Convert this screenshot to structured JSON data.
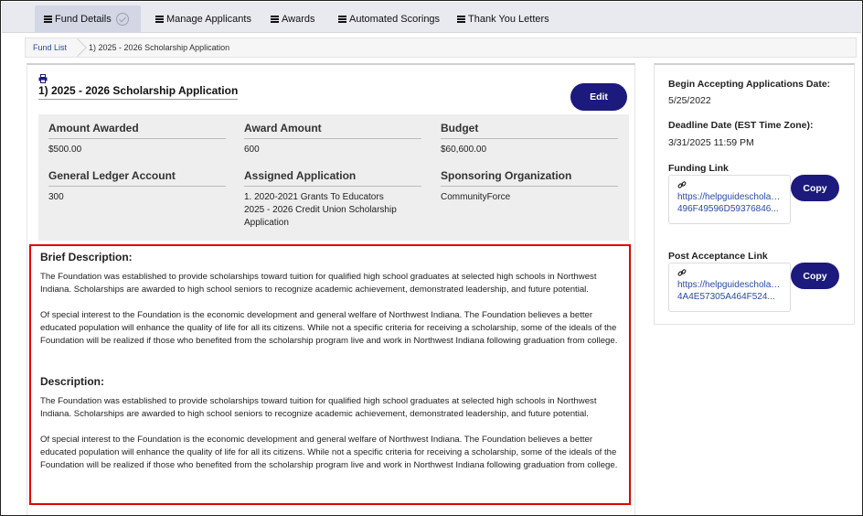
{
  "tabs": [
    {
      "label": "Fund Details"
    },
    {
      "label": "Manage Applicants"
    },
    {
      "label": "Awards"
    },
    {
      "label": "Automated Scorings"
    },
    {
      "label": "Thank You Letters"
    }
  ],
  "breadcrumb": {
    "root": "Fund List",
    "current": "1) 2025 - 2026 Scholarship Application"
  },
  "fund": {
    "title": "1) 2025 - 2026 Scholarship Application",
    "edit_label": "Edit",
    "amount_awarded": {
      "label": "Amount Awarded",
      "value": "$500.00"
    },
    "award_amount": {
      "label": "Award Amount",
      "value": "600"
    },
    "budget": {
      "label": "Budget",
      "value": "$60,600.00"
    },
    "gl_account": {
      "label": "General Ledger Account",
      "value": "300"
    },
    "assigned_application": {
      "label": "Assigned Application",
      "lines": [
        "1. 2020-2021 Grants To Educators",
        "2025 - 2026 Credit Union Scholarship",
        "Application"
      ]
    },
    "sponsoring_org": {
      "label": "Sponsoring Organization",
      "value": "CommunityForce"
    }
  },
  "descriptions": {
    "brief_title": "Brief Description:",
    "brief_p1": "The Foundation was established to provide scholarships toward tuition for qualified high school graduates at selected high schools in Northwest Indiana. Scholarships are awarded to high school seniors to recognize academic achievement, demonstrated leadership, and future potential.",
    "brief_p2": "Of special interest to the Foundation is the economic development and general welfare of Northwest Indiana. The Foundation believes a better educated population will enhance the quality of life for all its citizens. While not a specific criteria for receiving a scholarship, some of the ideals of the Foundation will be realized if those who benefited from the scholarship program live and work in Northwest Indiana following graduation from college.",
    "desc_title": "Description:",
    "desc_p1": "The Foundation was established to provide scholarships toward tuition for qualified high school graduates at selected high schools in Northwest Indiana. Scholarships are awarded to high school seniors to recognize academic achievement, demonstrated leadership, and future potential.",
    "desc_p2": "Of special interest to the Foundation is the economic development and general welfare of Northwest Indiana. The Foundation believes a better educated population will enhance the quality of life for all its citizens. While not a specific criteria for receiving a scholarship, some of the ideals of the Foundation will be realized if those who benefited from the scholarship program live and work in Northwest Indiana following graduation from college."
  },
  "sidebar": {
    "begin_label": "Begin Accepting Applications Date:",
    "begin_value": "5/25/2022",
    "deadline_label": "Deadline Date (EST Time Zone):",
    "deadline_value": "3/31/2025 11:59 PM",
    "funding_link_label": "Funding Link",
    "funding_link_line1": "https://helpguidescholarship...",
    "funding_link_line2": "496F49596D59376846...",
    "post_link_label": "Post Acceptance Link",
    "post_link_line1": "https://helpguidescholarship...",
    "post_link_line2": "4A4E57305A464F524...",
    "copy_label": "Copy"
  },
  "colors": {
    "accent": "#1c1a7c",
    "link": "#2a4ba8",
    "highlight_border": "#e00000"
  }
}
